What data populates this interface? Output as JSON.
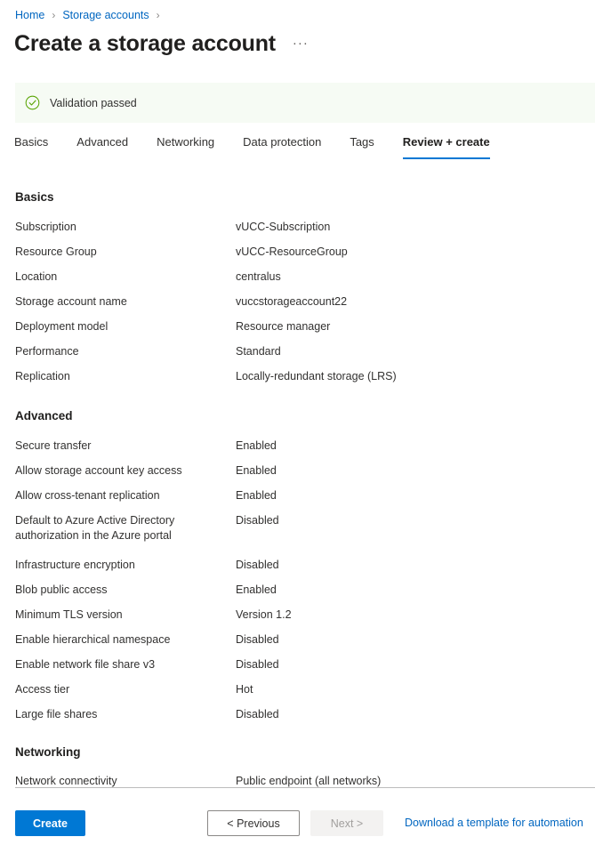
{
  "breadcrumb": {
    "items": [
      {
        "label": "Home"
      },
      {
        "label": "Storage accounts"
      }
    ],
    "separator": "›"
  },
  "header": {
    "title": "Create a storage account",
    "more_actions": "···"
  },
  "validation": {
    "icon": "check-circle-icon",
    "message": "Validation passed",
    "background": "#f6fbf4",
    "accent": "#57a300"
  },
  "tabs": [
    {
      "label": "Basics",
      "active": false
    },
    {
      "label": "Advanced",
      "active": false
    },
    {
      "label": "Networking",
      "active": false
    },
    {
      "label": "Data protection",
      "active": false
    },
    {
      "label": "Tags",
      "active": false
    },
    {
      "label": "Review + create",
      "active": true
    }
  ],
  "sections": {
    "basics": {
      "title": "Basics",
      "rows": [
        {
          "label": "Subscription",
          "value": "vUCC-Subscription"
        },
        {
          "label": "Resource Group",
          "value": "vUCC-ResourceGroup"
        },
        {
          "label": "Location",
          "value": "centralus"
        },
        {
          "label": "Storage account name",
          "value": "vuccstorageaccount22"
        },
        {
          "label": "Deployment model",
          "value": "Resource manager"
        },
        {
          "label": "Performance",
          "value": "Standard"
        },
        {
          "label": "Replication",
          "value": "Locally-redundant storage (LRS)"
        }
      ]
    },
    "advanced": {
      "title": "Advanced",
      "rows": [
        {
          "label": "Secure transfer",
          "value": "Enabled"
        },
        {
          "label": "Allow storage account key access",
          "value": "Enabled"
        },
        {
          "label": "Allow cross-tenant replication",
          "value": "Enabled"
        },
        {
          "label": "Default to Azure Active Directory authorization in the Azure portal",
          "value": "Disabled"
        },
        {
          "label": "Infrastructure encryption",
          "value": "Disabled"
        },
        {
          "label": "Blob public access",
          "value": "Enabled"
        },
        {
          "label": "Minimum TLS version",
          "value": "Version 1.2"
        },
        {
          "label": "Enable hierarchical namespace",
          "value": "Disabled"
        },
        {
          "label": "Enable network file share v3",
          "value": "Disabled"
        },
        {
          "label": "Access tier",
          "value": "Hot"
        },
        {
          "label": "Large file shares",
          "value": "Disabled"
        }
      ]
    },
    "networking": {
      "title": "Networking",
      "rows": [
        {
          "label": "Network connectivity",
          "value": "Public endpoint (all networks)"
        }
      ]
    }
  },
  "footer": {
    "create_label": "Create",
    "previous_label": "< Previous",
    "next_label": "Next >",
    "download_label": "Download a template for automation",
    "primary_color": "#0078d4",
    "link_color": "#0066c0"
  }
}
